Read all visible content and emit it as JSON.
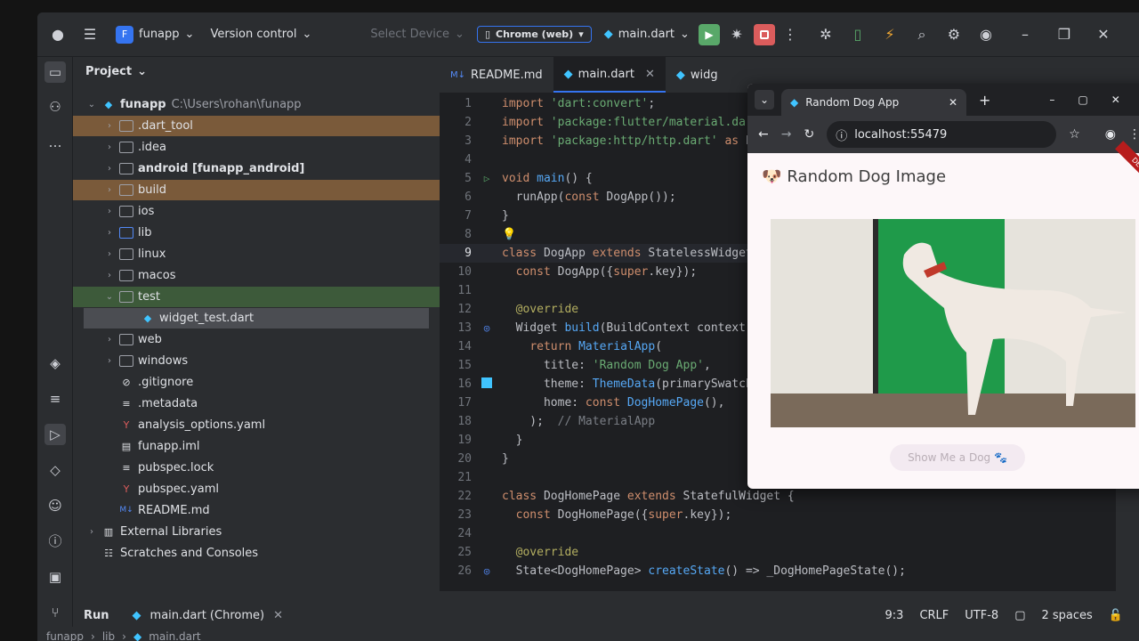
{
  "titlebar": {
    "project_badge": "F",
    "project_name": "funapp",
    "version_control": "Version control",
    "select_device": "Select Device",
    "device": "Chrome (web)",
    "run_config": "main.dart"
  },
  "project_panel": {
    "title": "Project",
    "root_name": "funapp",
    "root_path": "C:\\Users\\rohan\\funapp",
    "items": [
      {
        "label": ".dart_tool"
      },
      {
        "label": ".idea"
      },
      {
        "label": "android [funapp_android]"
      },
      {
        "label": "build"
      },
      {
        "label": "ios"
      },
      {
        "label": "lib"
      },
      {
        "label": "linux"
      },
      {
        "label": "macos"
      },
      {
        "label": "test"
      },
      {
        "label": "widget_test.dart"
      },
      {
        "label": "web"
      },
      {
        "label": "windows"
      },
      {
        "label": ".gitignore"
      },
      {
        "label": ".metadata"
      },
      {
        "label": "analysis_options.yaml"
      },
      {
        "label": "funapp.iml"
      },
      {
        "label": "pubspec.lock"
      },
      {
        "label": "pubspec.yaml"
      },
      {
        "label": "README.md"
      },
      {
        "label": "External Libraries"
      },
      {
        "label": "Scratches and Consoles"
      }
    ]
  },
  "editor": {
    "tabs": [
      "README.md",
      "main.dart",
      "widg"
    ],
    "line_numbers": [
      "1",
      "2",
      "3",
      "4",
      "5",
      "6",
      "7",
      "8",
      "9",
      "10",
      "11",
      "12",
      "13",
      "14",
      "15",
      "16",
      "17",
      "18",
      "19",
      "20",
      "21",
      "22",
      "23",
      "24",
      "25",
      "26"
    ]
  },
  "browser": {
    "tab_title": "Random Dog App",
    "url": "localhost:55479",
    "app_title": "Random Dog Image",
    "debug_banner": "DEBUG",
    "button_label": "Show Me a Dog 🐾"
  },
  "runbar": {
    "label": "Run",
    "config": "main.dart (Chrome)"
  },
  "status": {
    "position": "9:3",
    "line_sep": "CRLF",
    "encoding": "UTF-8",
    "indent": "2 spaces"
  },
  "breadcrumb": [
    "funapp",
    "lib",
    "main.dart"
  ],
  "colors": {
    "accent": "#3574f0",
    "run_green": "#59a869",
    "stop_red": "#db5c5c"
  }
}
